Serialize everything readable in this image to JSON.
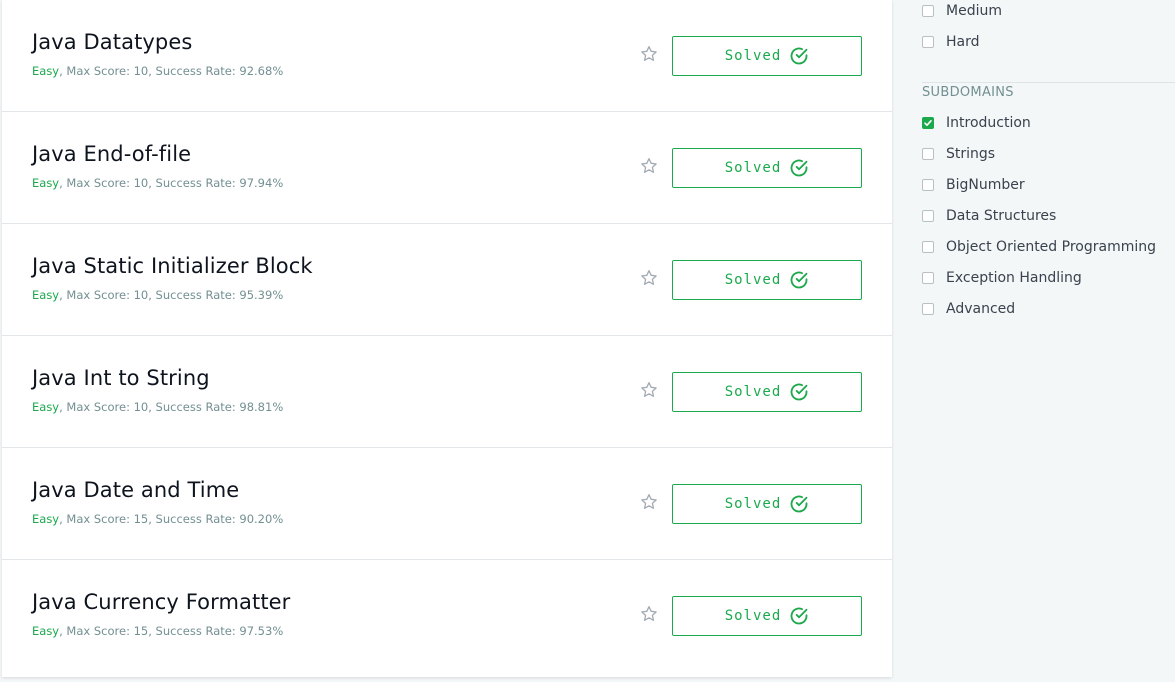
{
  "challenges": [
    {
      "title": "Java Datatypes",
      "difficulty": "Easy",
      "details": ", Max Score: 10, Success Rate: 92.68%",
      "status": "Solved"
    },
    {
      "title": "Java End-of-file",
      "difficulty": "Easy",
      "details": ", Max Score: 10, Success Rate: 97.94%",
      "status": "Solved"
    },
    {
      "title": "Java Static Initializer Block",
      "difficulty": "Easy",
      "details": ", Max Score: 10, Success Rate: 95.39%",
      "status": "Solved"
    },
    {
      "title": "Java Int to String",
      "difficulty": "Easy",
      "details": ", Max Score: 10, Success Rate: 98.81%",
      "status": "Solved"
    },
    {
      "title": "Java Date and Time",
      "difficulty": "Easy",
      "details": ", Max Score: 15, Success Rate: 90.20%",
      "status": "Solved"
    },
    {
      "title": "Java Currency Formatter",
      "difficulty": "Easy",
      "details": ", Max Score: 15, Success Rate: 97.53%",
      "status": "Solved"
    }
  ],
  "sidebar": {
    "difficulty_options": [
      {
        "label": "Medium",
        "checked": false
      },
      {
        "label": "Hard",
        "checked": false
      }
    ],
    "subdomains_title": "SUBDOMAINS",
    "subdomains": [
      {
        "label": "Introduction",
        "checked": true
      },
      {
        "label": "Strings",
        "checked": false
      },
      {
        "label": "BigNumber",
        "checked": false
      },
      {
        "label": "Data Structures",
        "checked": false
      },
      {
        "label": "Object Oriented Programming",
        "checked": false
      },
      {
        "label": "Exception Handling",
        "checked": false
      },
      {
        "label": "Advanced",
        "checked": false
      }
    ]
  },
  "icons": {
    "star": "star-outline-icon",
    "check": "check-circle-icon",
    "checkbox_tick": "checkmark-icon"
  },
  "colors": {
    "accent_green": "#1ba94c",
    "meta_gray": "#738f93",
    "title_dark": "#0e141e",
    "page_bg": "#f3f7f7"
  }
}
